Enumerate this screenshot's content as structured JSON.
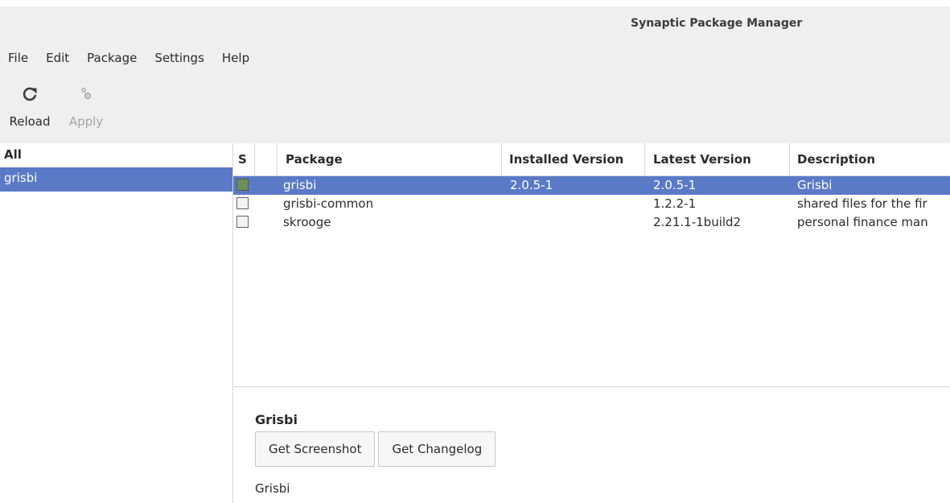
{
  "window": {
    "title": "Synaptic Package Manager"
  },
  "menu": {
    "items": [
      {
        "label": "File"
      },
      {
        "label": "Edit"
      },
      {
        "label": "Package"
      },
      {
        "label": "Settings"
      },
      {
        "label": "Help"
      }
    ]
  },
  "toolbar": {
    "reload_label": "Reload",
    "reload_icon": "reload-icon",
    "apply_label": "Apply",
    "apply_icon": "gears-icon"
  },
  "sidebar": {
    "header": "All",
    "items": [
      {
        "label": "grisbi",
        "selected": true
      }
    ]
  },
  "table": {
    "columns": {
      "status": "S",
      "package": "Package",
      "installed": "Installed Version",
      "latest": "Latest Version",
      "description": "Description"
    },
    "rows": [
      {
        "package": "grisbi",
        "installed": "2.0.5-1",
        "latest": "2.0.5-1",
        "description": "Grisbi",
        "status": "installed",
        "selected": true
      },
      {
        "package": "grisbi-common",
        "installed": "",
        "latest": "1.2.2-1",
        "description": "shared files for the fir",
        "status": "not-installed",
        "selected": false
      },
      {
        "package": "skrooge",
        "installed": "",
        "latest": "2.21.1-1build2",
        "description": "personal finance man",
        "status": "not-installed",
        "selected": false
      }
    ]
  },
  "details": {
    "title": "Grisbi",
    "screenshot_button": "Get Screenshot",
    "changelog_button": "Get Changelog",
    "description": "Grisbi"
  },
  "colors": {
    "selection": "#5a7ac8",
    "installed_box": "#6e8f5a",
    "chrome_bg": "#efefef"
  }
}
